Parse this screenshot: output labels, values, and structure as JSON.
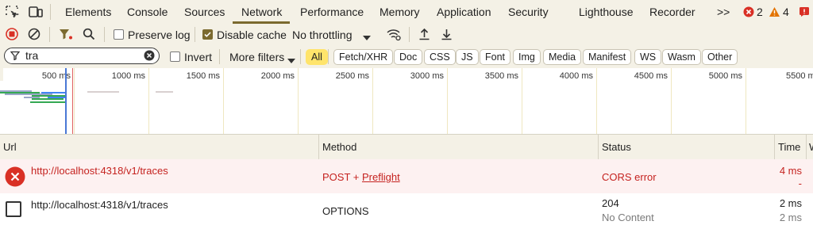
{
  "tabs": {
    "items": [
      "Elements",
      "Console",
      "Sources",
      "Network",
      "Performance",
      "Memory",
      "Application",
      "Security",
      "Lighthouse",
      "Recorder"
    ],
    "more": ">>",
    "errors_count": "2",
    "warnings_count": "4"
  },
  "toolbar": {
    "preserve_log": "Preserve log",
    "disable_cache": "Disable cache",
    "throttling": "No throttling"
  },
  "filter": {
    "value": "tra",
    "invert": "Invert",
    "more_filters": "More filters",
    "chips": [
      "All",
      "Fetch/XHR",
      "Doc",
      "CSS",
      "JS",
      "Font",
      "Img",
      "Media",
      "Manifest",
      "WS",
      "Wasm",
      "Other"
    ]
  },
  "overview": {
    "ticks": [
      "500 ms",
      "1000 ms",
      "1500 ms",
      "2000 ms",
      "2500 ms",
      "3000 ms",
      "3500 ms",
      "4000 ms",
      "4500 ms",
      "5000 ms",
      "5500 m"
    ]
  },
  "table": {
    "headers": {
      "url": "Url",
      "method": "Method",
      "status": "Status",
      "time": "Time"
    },
    "rows": [
      {
        "url": "http://localhost:4318/v1/traces",
        "method_prefix": "POST + ",
        "method_link": "Preflight",
        "status": "CORS error",
        "status_sub": "",
        "time": "4 ms",
        "time_sub": "-"
      },
      {
        "url": "http://localhost:4318/v1/traces",
        "method_prefix": "OPTIONS",
        "method_link": "",
        "status": "204",
        "status_sub": "No Content",
        "time": "2 ms",
        "time_sub": "2 ms"
      }
    ]
  },
  "colors": {
    "accent": "#7b6a2f",
    "error": "#c5221f",
    "chip_selected": "#ffe46b"
  }
}
